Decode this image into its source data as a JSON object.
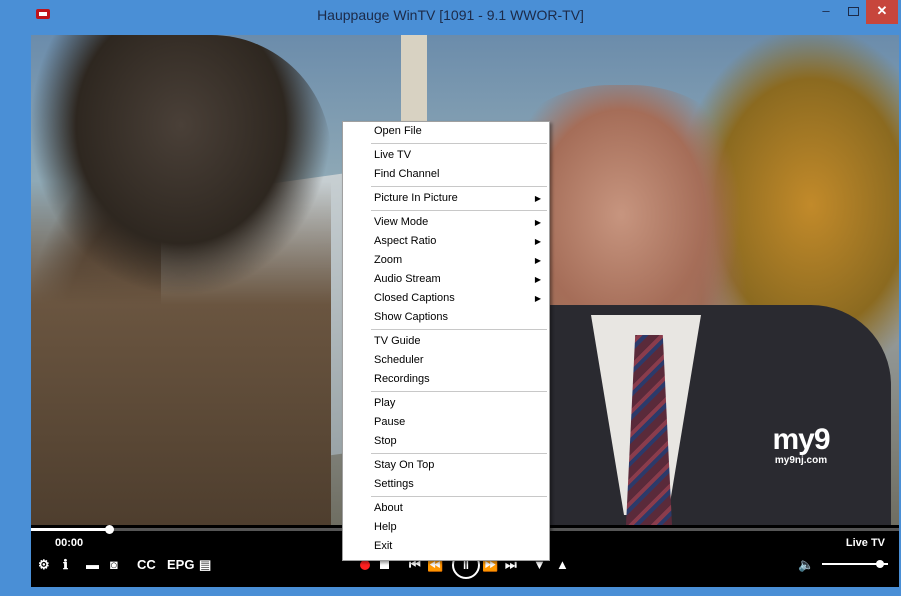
{
  "window": {
    "title": "Hauppauge WinTV [1091 - 9.1  WWOR-TV]",
    "min_glyph": "–",
    "close_glyph": "✕"
  },
  "video": {
    "watermark_main": "my9",
    "watermark_sub": "my9nj.com"
  },
  "controls": {
    "time": "00:00",
    "live_label": "Live TV",
    "seek_progress": 0.09,
    "volume_level": 0.88,
    "left_icons": [
      "gear-icon",
      "info-icon",
      "folder-icon",
      "camera-icon"
    ],
    "cc_label": "CC",
    "epg_label": "EPG",
    "gear_glyph": "⚙",
    "info_glyph": "ℹ",
    "folder_glyph": "▬",
    "camera_glyph": "◙",
    "doc_glyph": "▤",
    "prev_glyph": "⏮",
    "rewind_glyph": "⏪",
    "pause_glyph": "‖",
    "ffwd_glyph": "⏩",
    "next_glyph": "⏭",
    "down_glyph": "▼",
    "up_glyph": "▲",
    "volume_glyph": "🔈"
  },
  "context_menu": {
    "groups": [
      [
        {
          "label": "Open File"
        }
      ],
      [
        {
          "label": "Live TV"
        },
        {
          "label": "Find Channel"
        }
      ],
      [
        {
          "label": "Picture In Picture",
          "submenu": true
        }
      ],
      [
        {
          "label": "View Mode",
          "submenu": true
        },
        {
          "label": "Aspect Ratio",
          "submenu": true
        },
        {
          "label": "Zoom",
          "submenu": true
        },
        {
          "label": "Audio Stream",
          "submenu": true
        },
        {
          "label": "Closed Captions",
          "submenu": true
        },
        {
          "label": "Show Captions"
        }
      ],
      [
        {
          "label": "TV Guide"
        },
        {
          "label": "Scheduler"
        },
        {
          "label": "Recordings"
        }
      ],
      [
        {
          "label": "Play"
        },
        {
          "label": "Pause"
        },
        {
          "label": "Stop"
        }
      ],
      [
        {
          "label": "Stay On Top"
        },
        {
          "label": "Settings"
        }
      ],
      [
        {
          "label": "About"
        },
        {
          "label": "Help"
        },
        {
          "label": "Exit"
        }
      ]
    ],
    "submenu_glyph": "▶"
  }
}
